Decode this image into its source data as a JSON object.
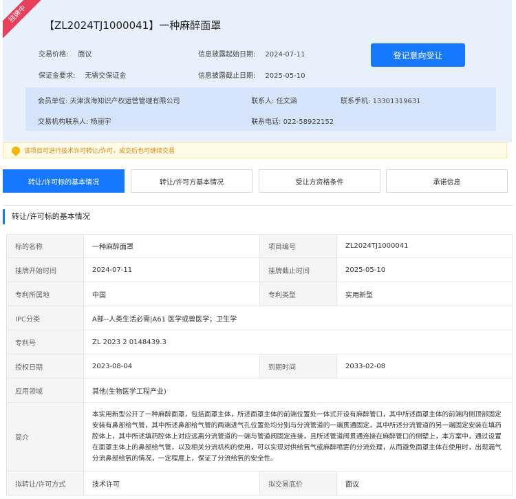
{
  "header": {
    "ribbon": "挂牌中",
    "title": "【ZL2024TJ1000041】一种麻醉面罩",
    "price_label": "交易价格:",
    "price_value": "面议",
    "deposit_label": "保证金要求:",
    "deposit_value": "无需交保证金",
    "start_label": "信息披露起始日期:",
    "start_value": "2024-07-11",
    "end_label": "信息披露截止日期:",
    "end_value": "2025-05-10",
    "register_button": "登记意向受让"
  },
  "contact": {
    "member_label": "会员单位:",
    "member_value": "天津滨海知识产权运营管理有限公司",
    "contact_label": "联系人:",
    "contact_value": "任文涵",
    "mobile_label": "联系手机:",
    "mobile_value": "13301319631",
    "agency_label": "交易机构联系人:",
    "agency_value": "杨丽宇",
    "phone_label": "联系电话:",
    "phone_value": "022-58922152"
  },
  "notice": "该项目可进行技术许可转让/许可，成交后也可继续交易",
  "tabs": [
    "转让/许可标的基本情况",
    "转让/许可方基本情况",
    "受让方资格条件",
    "承诺信息"
  ],
  "section_title": "转让/许可标的基本情况",
  "table": {
    "name_label": "标的名称",
    "name_value": "一种麻醉面罩",
    "project_no_label": "项目编号",
    "project_no_value": "ZL2024TJ1000041",
    "list_start_label": "挂牌开始时间",
    "list_start_value": "2024-07-11",
    "list_end_label": "挂牌截止时间",
    "list_end_value": "2025-05-10",
    "country_label": "专利所属地",
    "country_value": "中国",
    "type_label": "专利类型",
    "type_value": "实用新型",
    "ipc_label": "IPC分类",
    "ipc_value": "A部--人类生活必需|A61 医学或兽医学；卫生学",
    "patent_no_label": "专利号",
    "patent_no_value": "ZL 2023 2 0148439.3",
    "grant_label": "授权日期",
    "grant_value": "2023-08-04",
    "expire_label": "到期时间",
    "expire_value": "2033-02-08",
    "field_label": "应用领域",
    "field_value": "其他(生物医学工程产业)",
    "intro_label": "简介",
    "intro_value": "本实用新型公开了一种麻醉面罩，包括面罩主体，所述面罩主体的前端位置处一体式开设有麻醉管口，其中所述面罩主体的前端内侧顶部固定安装有鼻部给气管，其中所述鼻部给气管的两端进气孔位置处均分别与分流管道的一端贯通固定，其中所述分流管道的另一端固定安装在填药腔体上，其中所述填药腔体上对应远离分流管道的一端与管道阀固定连接，且所述管道阀贯通连接在麻醉管口的侧壁上，本方案中，通过设置在面罩主体上的鼻部给气管，以及相关分流机构的使用，可以实现对供给氧气或麻醉喷雾的分流处理，从而避免面罩主体在使用时，出现漏气分流鼻部给氧的情况，一定程度上，保证了分流给氧的安全性。",
    "method_label": "拟转让/许可方式",
    "method_value": "技术许可",
    "base_price_label": "拟交易底价",
    "base_price_value": "面议"
  }
}
